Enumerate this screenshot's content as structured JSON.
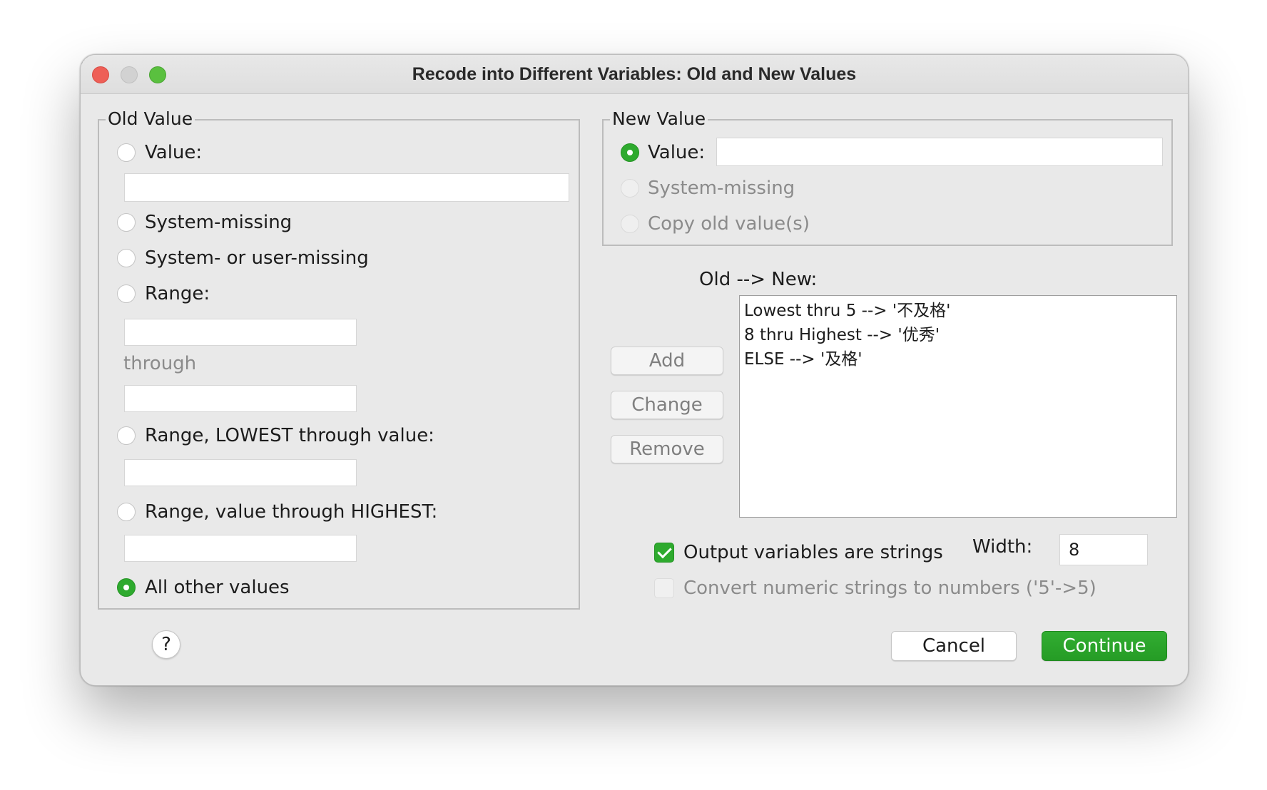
{
  "window": {
    "title": "Recode into Different Variables: Old and New Values"
  },
  "old_value": {
    "legend": "Old Value",
    "value_label": "Value:",
    "value_input": "",
    "system_missing_label": "System-missing",
    "system_or_user_missing_label": "System- or user-missing",
    "range_label": "Range:",
    "range_from_input": "",
    "through_label": "through",
    "range_to_input": "",
    "range_lowest_label": "Range, LOWEST through value:",
    "range_lowest_input": "",
    "range_highest_label": "Range, value through HIGHEST:",
    "range_highest_input": "",
    "all_other_label": "All other values",
    "selected": "all_other_values"
  },
  "new_value": {
    "legend": "New Value",
    "value_label": "Value:",
    "value_input": "",
    "system_missing_label": "System-missing",
    "copy_old_label": "Copy old value(s)",
    "selected": "value"
  },
  "mapping": {
    "label": "Old --> New:",
    "items": [
      "Lowest thru 5 --> '不及格'",
      "8 thru Highest --> '优秀'",
      "ELSE --> '及格'"
    ]
  },
  "buttons": {
    "add": "Add",
    "change": "Change",
    "remove": "Remove",
    "cancel": "Cancel",
    "continue": "Continue",
    "help": "?"
  },
  "options": {
    "output_strings_label": "Output variables are strings",
    "output_strings_checked": true,
    "width_label": "Width:",
    "width_value": "8",
    "convert_numeric_label": "Convert numeric strings to numbers ('5'->5)",
    "convert_numeric_checked": false
  },
  "colors": {
    "accent": "#2eaa2e",
    "window_bg": "#e9e9e9"
  }
}
